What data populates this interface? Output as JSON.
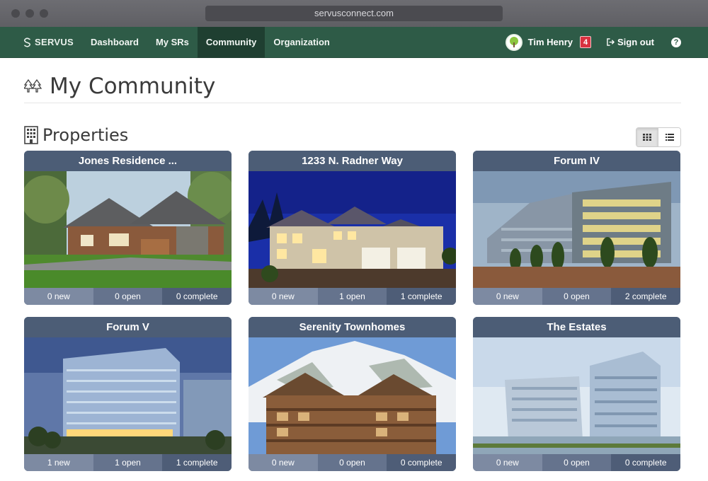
{
  "browser": {
    "url": "servusconnect.com"
  },
  "nav": {
    "brand": "SERVUS",
    "items": [
      {
        "label": "Dashboard",
        "active": false
      },
      {
        "label": "My SRs",
        "active": false
      },
      {
        "label": "Community",
        "active": true
      },
      {
        "label": "Organization",
        "active": false
      }
    ],
    "user": {
      "name": "Tim Henry",
      "notifications": "4"
    },
    "sign_out": "Sign out",
    "help": "?"
  },
  "page": {
    "title": "My Community",
    "section": "Properties"
  },
  "properties": [
    {
      "name": "Jones Residence ...",
      "image": "craftsman-house-photo",
      "new": "0 new",
      "open": "0 open",
      "complete": "0 complete"
    },
    {
      "name": "1233 N. Radner Way",
      "image": "house-at-dusk-photo",
      "new": "0 new",
      "open": "1 open",
      "complete": "1 complete"
    },
    {
      "name": "Forum IV",
      "image": "glass-office-building-photo",
      "new": "0 new",
      "open": "0 open",
      "complete": "2 complete"
    },
    {
      "name": "Forum V",
      "image": "office-tower-evening-photo",
      "new": "1 new",
      "open": "1 open",
      "complete": "1 complete"
    },
    {
      "name": "Serenity Townhomes",
      "image": "mountain-lodge-photo",
      "new": "0 new",
      "open": "0 open",
      "complete": "0 complete"
    },
    {
      "name": "The Estates",
      "image": "twin-towers-photo",
      "new": "0 new",
      "open": "0 open",
      "complete": "0 complete"
    }
  ],
  "colors": {
    "nav": "#2e5b47",
    "card_header": "#4c5d76",
    "badge": "#d9313f"
  }
}
